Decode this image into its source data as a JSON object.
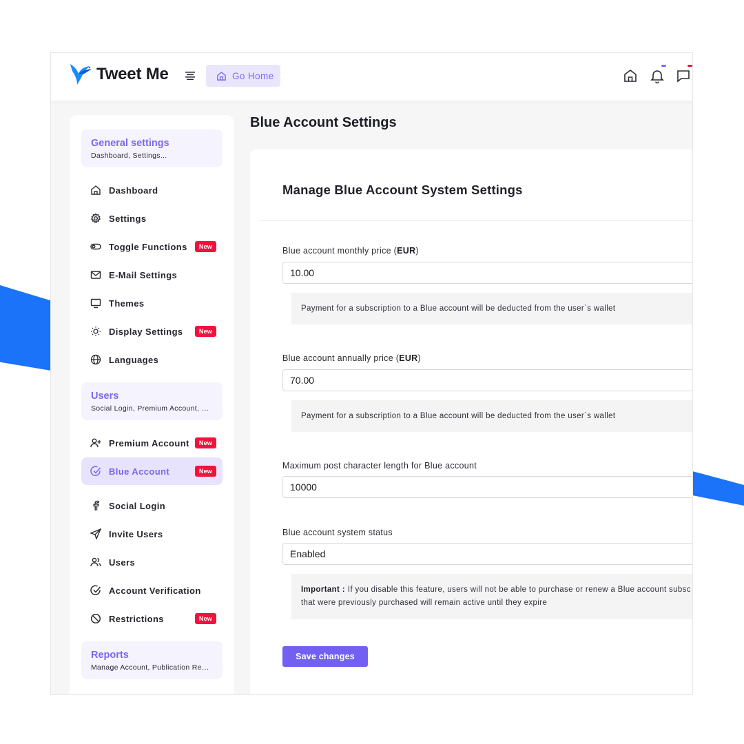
{
  "colors": {
    "accent": "#7360f2",
    "brand_blue": "#1a73f8",
    "badge": "#f1133c"
  },
  "header": {
    "app_name": "Tweet Me",
    "go_home_label": "Go Home",
    "icons": [
      "menu-icon",
      "home-icon",
      "bell-icon",
      "chat-icon"
    ]
  },
  "sidebar": {
    "groups": [
      {
        "title": "General settings",
        "subtitle": "Dashboard, Settings..."
      },
      {
        "title": "Users",
        "subtitle": "Social Login, Premium Account, Users..."
      },
      {
        "title": "Reports",
        "subtitle": "Manage Account, Publication Reports..."
      }
    ],
    "items": [
      {
        "label": "Dashboard",
        "icon": "home-icon"
      },
      {
        "label": "Settings",
        "icon": "gear-icon"
      },
      {
        "label": "Toggle Functions",
        "icon": "toggle-icon",
        "badge": "New"
      },
      {
        "label": "E-Mail Settings",
        "icon": "mail-icon"
      },
      {
        "label": "Themes",
        "icon": "monitor-icon"
      },
      {
        "label": "Display Settings",
        "icon": "sun-icon",
        "badge": "New"
      },
      {
        "label": "Languages",
        "icon": "globe-icon"
      },
      {
        "label": "Premium Account",
        "icon": "user-plus-icon",
        "badge": "New"
      },
      {
        "label": "Blue Account",
        "icon": "check-circle-icon",
        "badge": "New",
        "active": true
      },
      {
        "label": "Social Login",
        "icon": "facebook-icon"
      },
      {
        "label": "Invite Users",
        "icon": "send-icon"
      },
      {
        "label": "Users",
        "icon": "users-icon"
      },
      {
        "label": "Account Verification",
        "icon": "verify-icon"
      },
      {
        "label": "Restrictions",
        "icon": "ban-icon",
        "badge": "New"
      }
    ]
  },
  "main": {
    "page_title": "Blue Account Settings",
    "card_title": "Manage Blue Account System Settings",
    "fields": [
      {
        "label": "Blue account monthly price (",
        "label_bold": "EUR",
        "label_end": ")",
        "value": "10.00",
        "hint": "Payment for a subscription to a Blue account will be deducted from the user`s wallet"
      },
      {
        "label": "Blue account annually price (",
        "label_bold": "EUR",
        "label_end": ")",
        "value": "70.00",
        "hint": "Payment for a subscription to a Blue account will be deducted from the user`s wallet"
      },
      {
        "label": "Maximum post character length for Blue account",
        "value": "10000"
      },
      {
        "label": "Blue account system status",
        "value": "Enabled",
        "hint_bold": "Important :",
        "hint_line1": "If you disable this feature, users will not be able to purchase or renew a Blue account subsc",
        "hint_line2": "that were previously purchased will remain active until they expire"
      }
    ],
    "save_label": "Save changes"
  }
}
